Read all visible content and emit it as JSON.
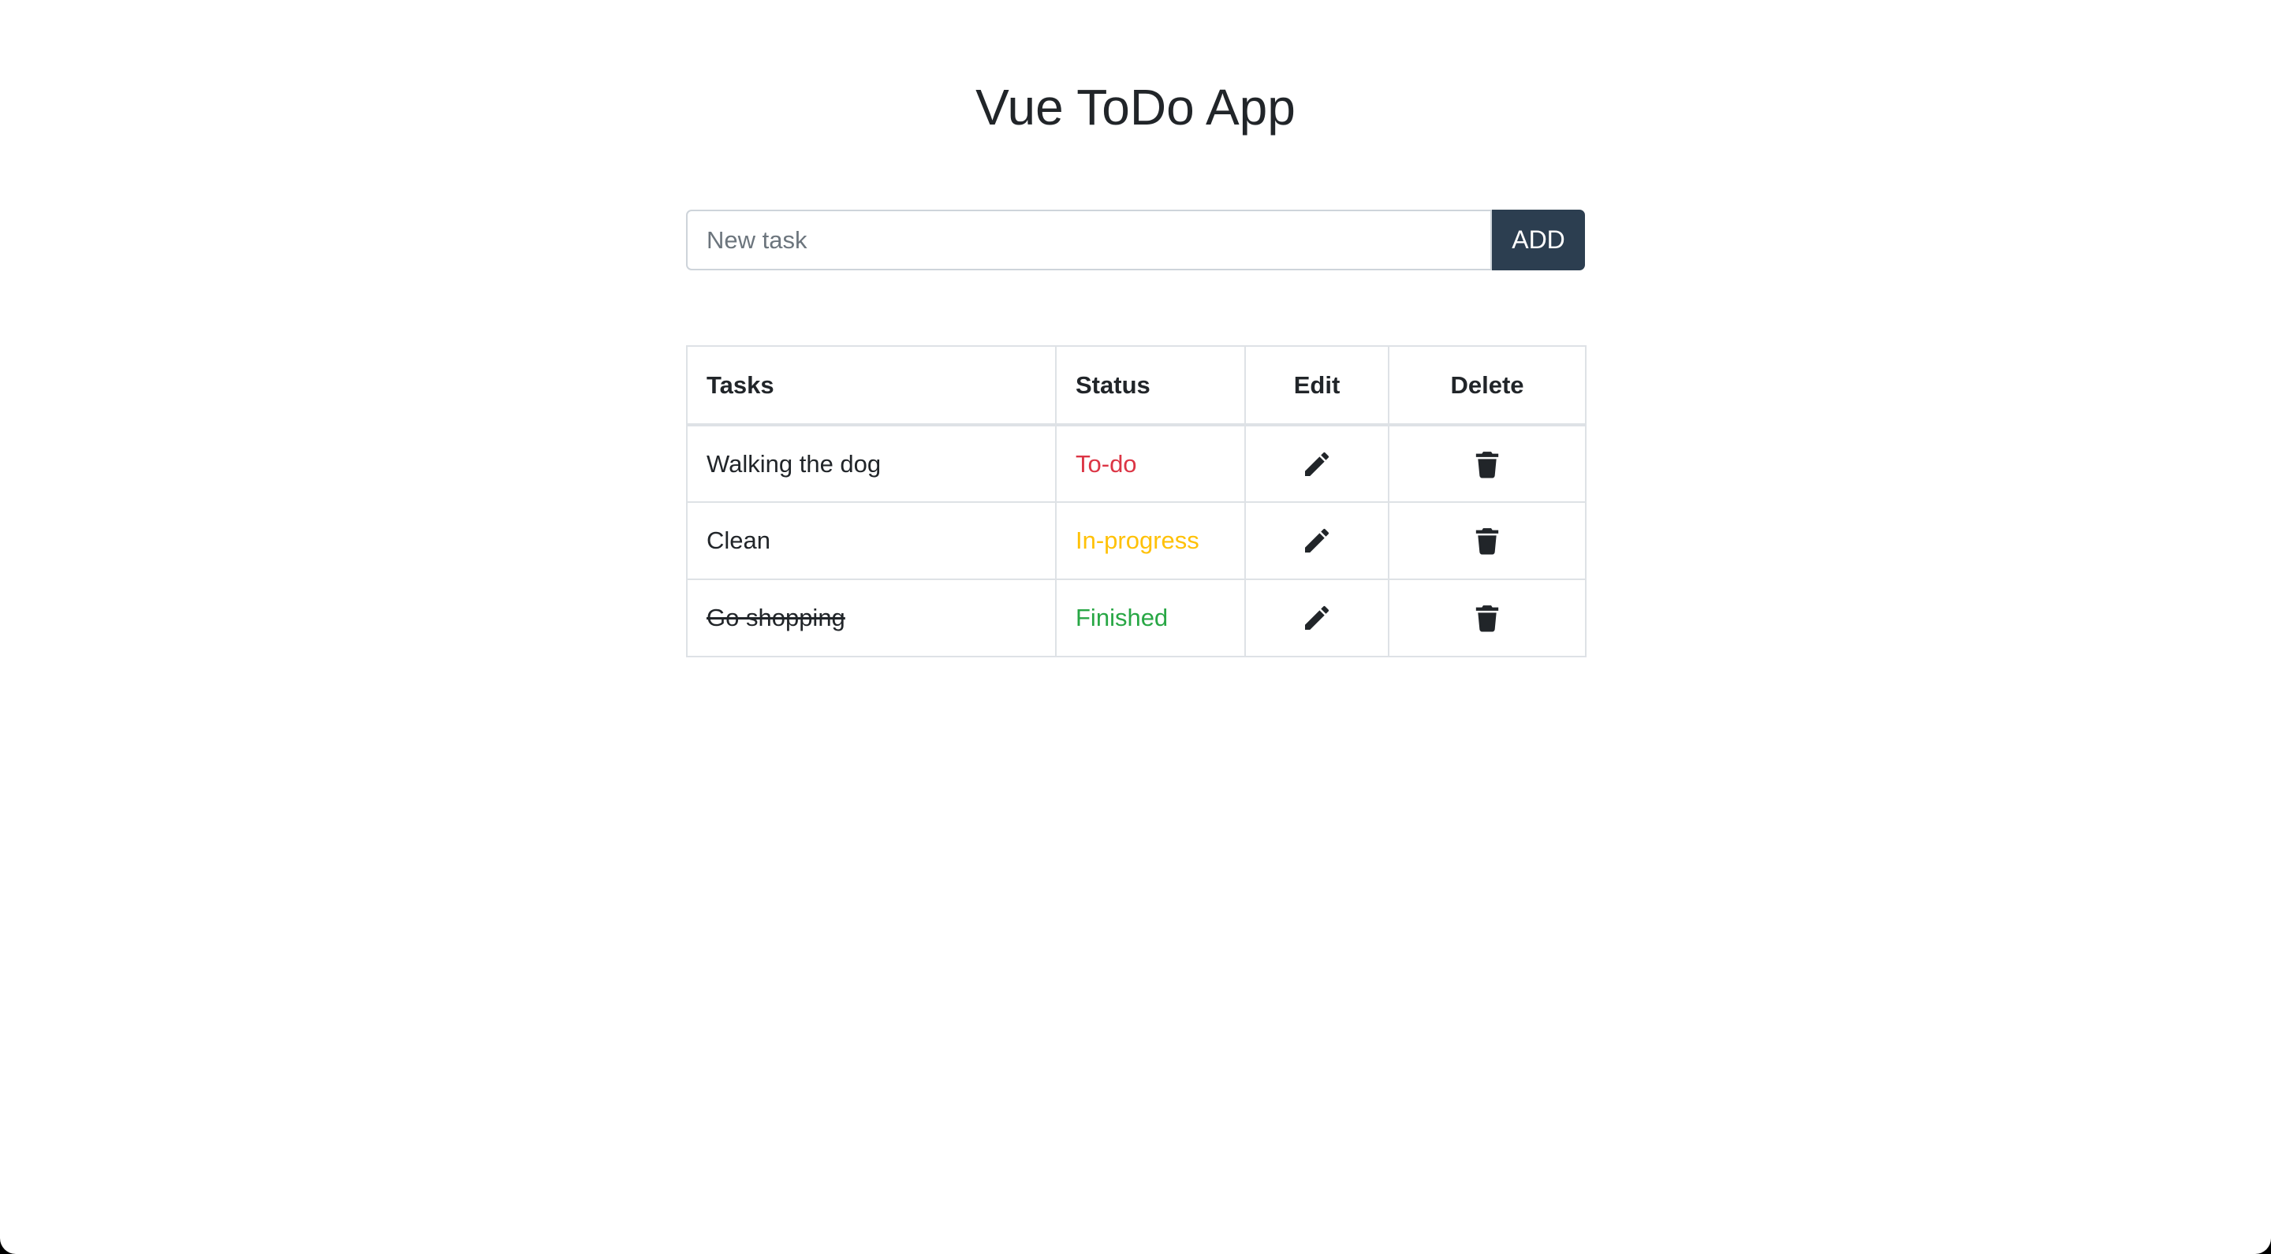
{
  "app": {
    "title": "Vue ToDo App"
  },
  "new_task": {
    "placeholder": "New task",
    "value": "",
    "add_label": "ADD"
  },
  "table": {
    "headers": {
      "tasks": "Tasks",
      "status": "Status",
      "edit": "Edit",
      "delete": "Delete"
    },
    "rows": [
      {
        "name": "Walking the dog",
        "status": "To-do",
        "status_color": "#dc3545",
        "finished": false,
        "edit_icon": "pencil-icon",
        "delete_icon": "trash-icon"
      },
      {
        "name": "Clean",
        "status": "In-progress",
        "status_color": "#ffc107",
        "finished": false,
        "edit_icon": "pencil-icon",
        "delete_icon": "trash-icon"
      },
      {
        "name": "Go shopping",
        "status": "Finished",
        "status_color": "#28a745",
        "finished": true,
        "edit_icon": "pencil-icon",
        "delete_icon": "trash-icon"
      }
    ]
  },
  "colors": {
    "accent": "#2c3e50",
    "text": "#212529",
    "border": "#dee2e6"
  }
}
